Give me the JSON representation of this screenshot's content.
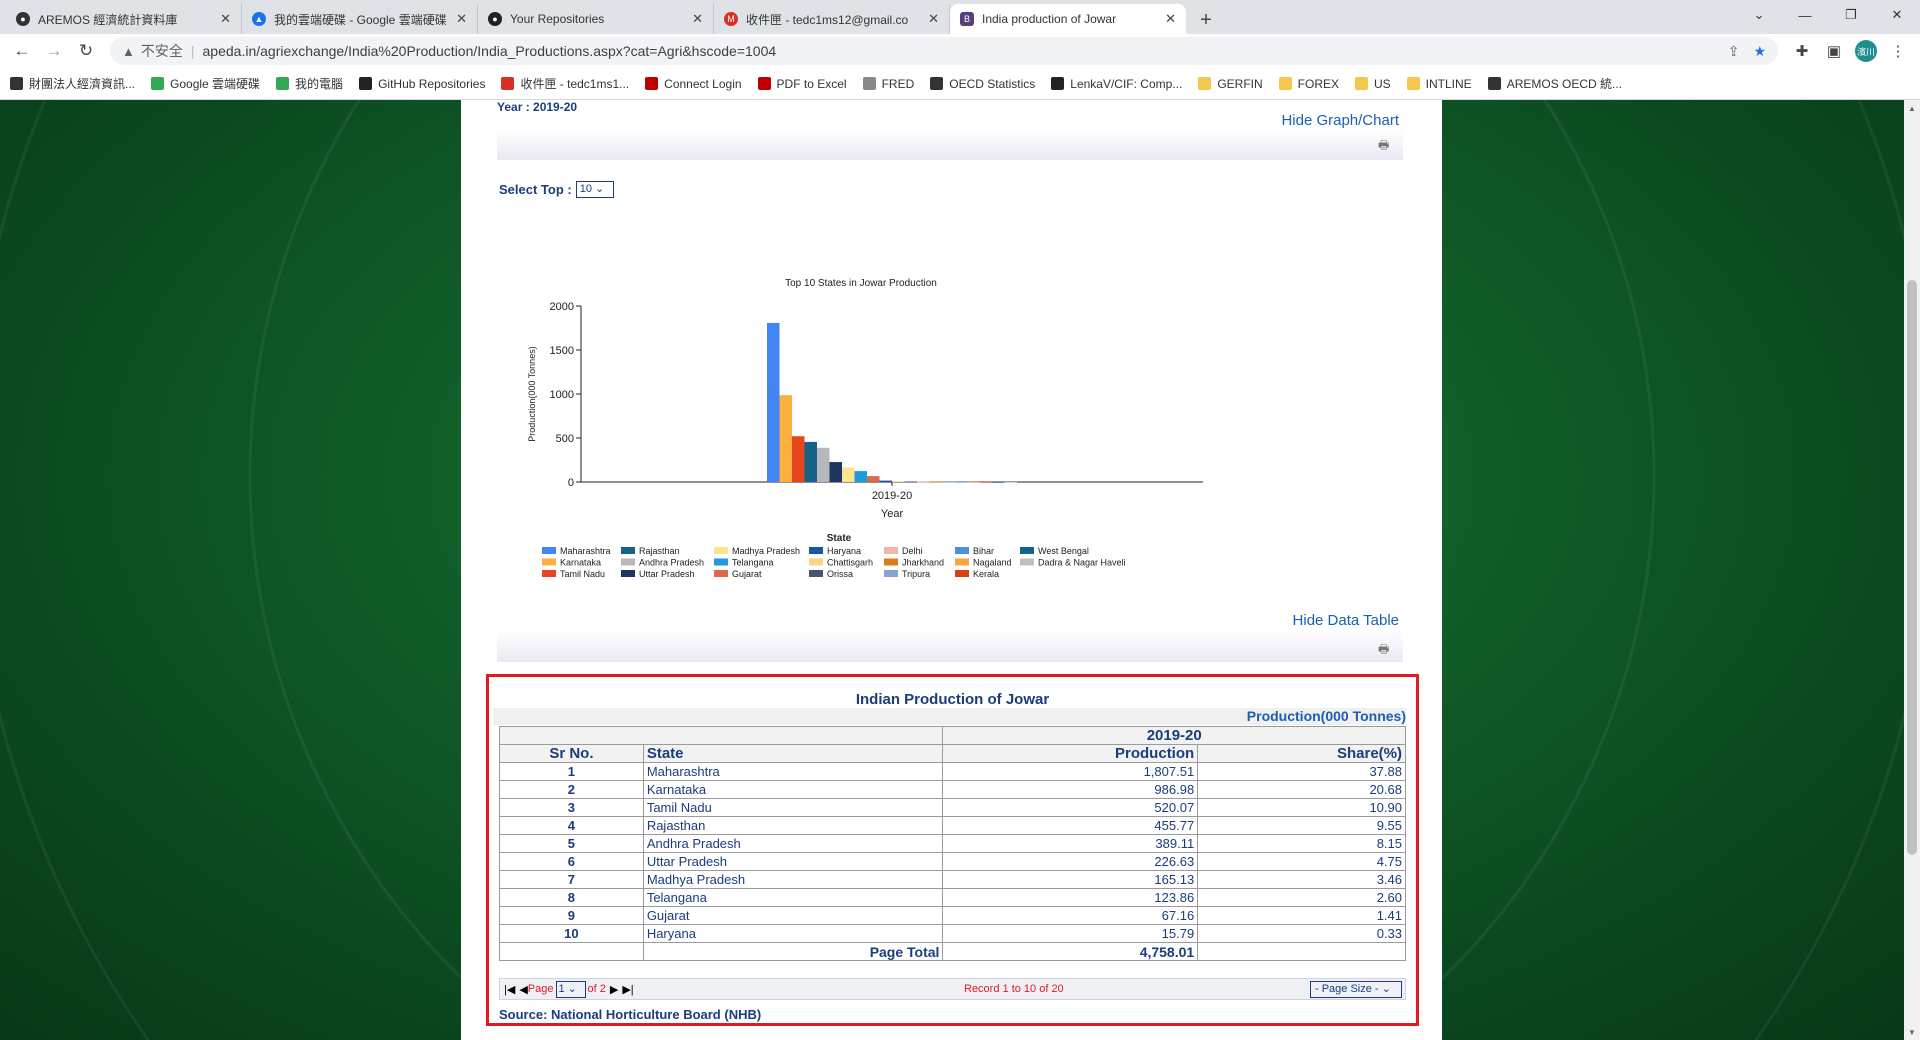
{
  "browser": {
    "tabs": [
      {
        "title": "AREMOS 經濟統計資料庫",
        "icon_color": "#333333"
      },
      {
        "title": "我的雲端硬碟 - Google 雲端硬碟",
        "icon_color": "#1a73e8"
      },
      {
        "title": "Your Repositories",
        "icon_color": "#222222"
      },
      {
        "title": "收件匣 - tedc1ms12@gmail.co",
        "icon_color": "#d93025"
      },
      {
        "title": "India production of Jowar",
        "icon_color": "#563d7c",
        "active": true
      }
    ],
    "new_tab": "+",
    "window_controls": [
      "⌄",
      "—",
      "❐",
      "✕"
    ],
    "insecure_label": "不安全",
    "url": "apeda.in/agriexchange/India%20Production/India_Productions.aspx?cat=Agri&hscode=1004",
    "avatar_text": "濱川",
    "bookmarks": [
      {
        "label": "財團法人經濟資訊...",
        "color": "#333333"
      },
      {
        "label": "Google 雲端硬碟",
        "color": "#34a853"
      },
      {
        "label": "我的電腦",
        "color": "#34a853"
      },
      {
        "label": "GitHub Repositories",
        "color": "#222222"
      },
      {
        "label": "收件匣 - tedc1ms1...",
        "color": "#d93025"
      },
      {
        "label": "Connect Login",
        "color": "#c00000"
      },
      {
        "label": "PDF to Excel",
        "color": "#c00000"
      },
      {
        "label": "FRED",
        "color": "#888888"
      },
      {
        "label": "OECD Statistics",
        "color": "#333333"
      },
      {
        "label": "LenkaV/CIF: Comp...",
        "color": "#222222"
      },
      {
        "label": "GERFIN",
        "color": "#f2c94c"
      },
      {
        "label": "FOREX",
        "color": "#f2c94c"
      },
      {
        "label": "US",
        "color": "#f2c94c"
      },
      {
        "label": "INTLINE",
        "color": "#f2c94c"
      },
      {
        "label": "AREMOS OECD 統...",
        "color": "#333333"
      }
    ]
  },
  "page": {
    "year_label": "Year : 2019-20",
    "hide_graph": "Hide Graph/Chart",
    "select_top_label": "Select Top :",
    "select_top_value": "10",
    "hide_table": "Hide Data Table"
  },
  "chart_data": {
    "type": "bar",
    "title": "Top 10 States in Jowar Production",
    "xlabel": "Year",
    "ylabel": "Production(000 Tonnes)",
    "categories": [
      "2019-20"
    ],
    "ylim": [
      0,
      2000
    ],
    "yticks": [
      0,
      500,
      1000,
      1500,
      2000
    ],
    "legend_title": "State",
    "series": [
      {
        "name": "Maharashtra",
        "values": [
          1807.51
        ],
        "color": "#4285f4"
      },
      {
        "name": "Karnataka",
        "values": [
          986.98
        ],
        "color": "#fbb040"
      },
      {
        "name": "Tamil Nadu",
        "values": [
          520.07
        ],
        "color": "#e8441d"
      },
      {
        "name": "Rajasthan",
        "values": [
          455.77
        ],
        "color": "#16628a"
      },
      {
        "name": "Andhra Pradesh",
        "values": [
          389.11
        ],
        "color": "#b8b8bc"
      },
      {
        "name": "Uttar Pradesh",
        "values": [
          226.63
        ],
        "color": "#1e3560"
      },
      {
        "name": "Madhya Pradesh",
        "values": [
          165.13
        ],
        "color": "#fde38c"
      },
      {
        "name": "Telangana",
        "values": [
          123.86
        ],
        "color": "#1e9ae0"
      },
      {
        "name": "Gujarat",
        "values": [
          67.16
        ],
        "color": "#d96a4a"
      },
      {
        "name": "Haryana",
        "values": [
          15.79
        ],
        "color": "#1e54a8"
      },
      {
        "name": "Chattisgarh",
        "values": [
          8
        ],
        "color": "#f9d38a"
      },
      {
        "name": "Orissa",
        "values": [
          6
        ],
        "color": "#4a5570"
      },
      {
        "name": "Delhi",
        "values": [
          5
        ],
        "color": "#f4b6a6"
      },
      {
        "name": "Jharkhand",
        "values": [
          4
        ],
        "color": "#e07b1a"
      },
      {
        "name": "Tripura",
        "values": [
          3
        ],
        "color": "#8aa3c8"
      },
      {
        "name": "Bihar",
        "values": [
          3
        ],
        "color": "#4a8fe0"
      },
      {
        "name": "Nagaland",
        "values": [
          2
        ],
        "color": "#f9a545"
      },
      {
        "name": "Kerala",
        "values": [
          2
        ],
        "color": "#d84015"
      },
      {
        "name": "West Bengal",
        "values": [
          1
        ],
        "color": "#16628a"
      },
      {
        "name": "Dadra & Nagar Haveli",
        "values": [
          1
        ],
        "color": "#c0c0c4"
      }
    ]
  },
  "data_table": {
    "title": "Indian Production of Jowar",
    "unit": "Production(000 Tonnes)",
    "year_header": "2019-20",
    "headers": {
      "sr": "Sr No.",
      "state": "State",
      "production": "Production",
      "share": "Share(%)"
    },
    "rows": [
      {
        "sr": "1",
        "state": "Maharashtra",
        "production": "1,807.51",
        "share": "37.88"
      },
      {
        "sr": "2",
        "state": "Karnataka",
        "production": "986.98",
        "share": "20.68"
      },
      {
        "sr": "3",
        "state": "Tamil Nadu",
        "production": "520.07",
        "share": "10.90"
      },
      {
        "sr": "4",
        "state": "Rajasthan",
        "production": "455.77",
        "share": "9.55"
      },
      {
        "sr": "5",
        "state": "Andhra Pradesh",
        "production": "389.11",
        "share": "8.15"
      },
      {
        "sr": "6",
        "state": "Uttar Pradesh",
        "production": "226.63",
        "share": "4.75"
      },
      {
        "sr": "7",
        "state": "Madhya Pradesh",
        "production": "165.13",
        "share": "3.46"
      },
      {
        "sr": "8",
        "state": "Telangana",
        "production": "123.86",
        "share": "2.60"
      },
      {
        "sr": "9",
        "state": "Gujarat",
        "production": "67.16",
        "share": "1.41"
      },
      {
        "sr": "10",
        "state": "Haryana",
        "production": "15.79",
        "share": "0.33"
      }
    ],
    "total_label": "Page Total",
    "total_value": "4,758.01",
    "pager": {
      "page_label": "Page",
      "page_value": "1",
      "of_label": "of 2",
      "record_text": "Record 1 to 10 of 20",
      "page_size_label": "- Page Size -"
    },
    "source": "Source: National Horticulture Board (NHB)"
  }
}
